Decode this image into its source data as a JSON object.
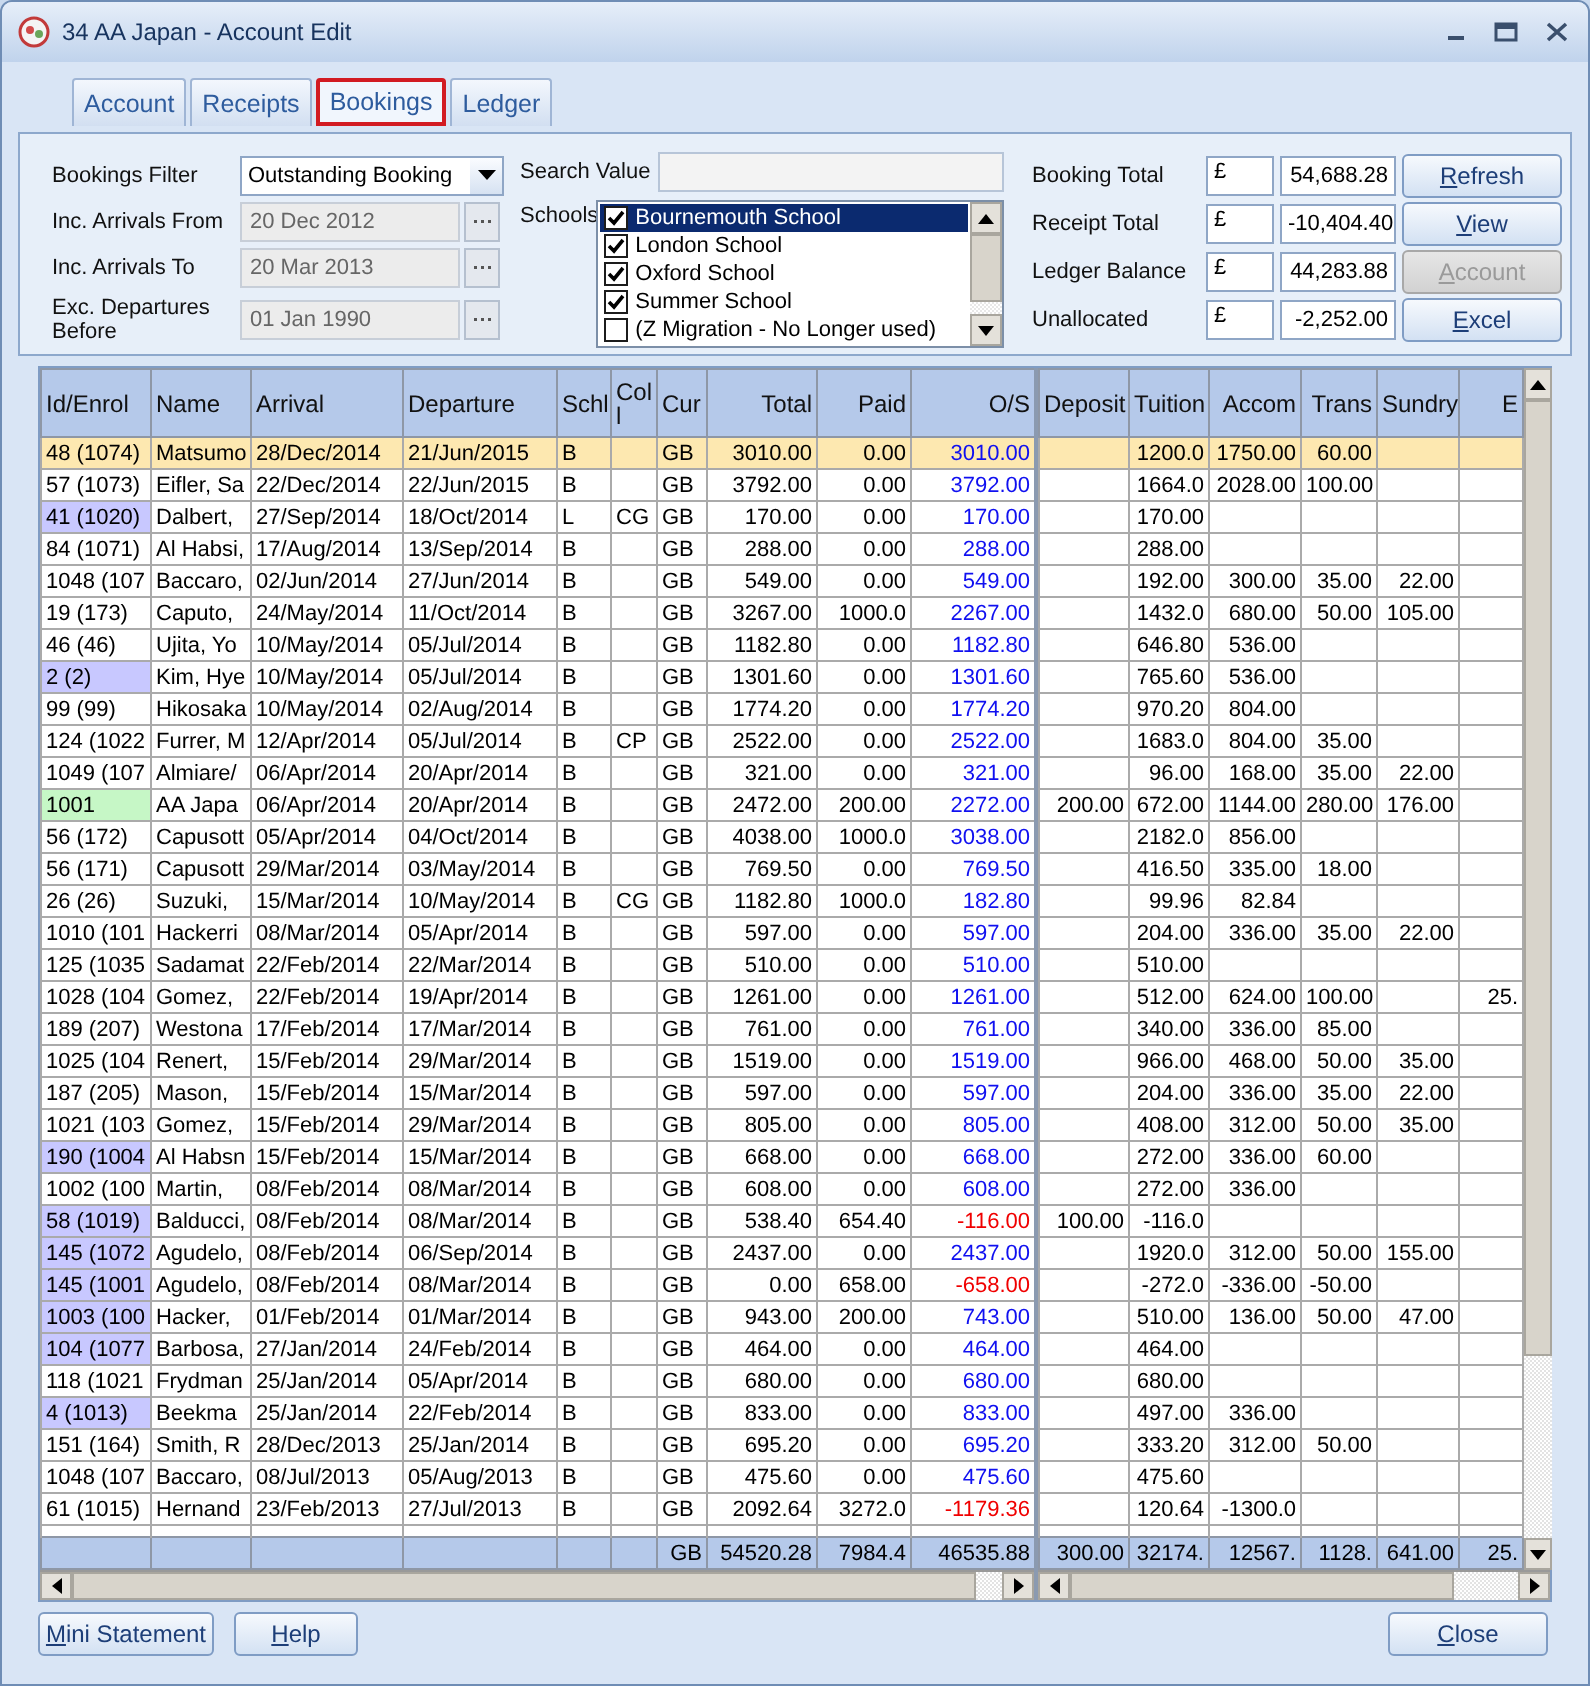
{
  "window": {
    "title": "34 AA Japan - Account Edit"
  },
  "tabs": [
    {
      "label": "Account",
      "selected": false
    },
    {
      "label": "Receipts",
      "selected": false
    },
    {
      "label": "Bookings",
      "selected": true
    },
    {
      "label": "Ledger",
      "selected": false
    }
  ],
  "filter": {
    "bookings_filter": {
      "label": "Bookings Filter",
      "value": "Outstanding Booking"
    },
    "dates": [
      {
        "label": "Inc. Arrivals From",
        "value": "20 Dec 2012",
        "disabled": true
      },
      {
        "label": "Inc. Arrivals To",
        "value": "20 Mar 2013",
        "disabled": true
      },
      {
        "label": "Exc. Departures Before",
        "value": "01 Jan 1990",
        "disabled": true
      }
    ],
    "search": {
      "label": "Search Value"
    },
    "schools": {
      "label": "Schools",
      "items": [
        {
          "label": "Bournemouth School",
          "checked": true,
          "selected": true
        },
        {
          "label": "London School",
          "checked": true,
          "selected": false
        },
        {
          "label": "Oxford School",
          "checked": true,
          "selected": false
        },
        {
          "label": "Summer School",
          "checked": true,
          "selected": false
        },
        {
          "label": "(Z Migration - No Longer used)",
          "checked": false,
          "selected": false
        }
      ]
    },
    "totals": [
      {
        "label": "Booking Total",
        "currency": "£",
        "value": "54,688.28",
        "button": "Refresh",
        "disabled": false
      },
      {
        "label": "Receipt Total",
        "currency": "£",
        "value": "-10,404.40",
        "button": "View",
        "disabled": false
      },
      {
        "label": "Ledger Balance",
        "currency": "£",
        "value": "44,283.88",
        "button": "Account",
        "disabled": true
      },
      {
        "label": "Unallocated",
        "currency": "£",
        "value": "-2,252.00",
        "button": "Excel",
        "disabled": false
      }
    ]
  },
  "grid": {
    "columns_left": [
      {
        "label": "Id/Enrol"
      },
      {
        "label": "Name"
      },
      {
        "label": "Arrival"
      },
      {
        "label": "Departure"
      },
      {
        "label": "Schl"
      },
      {
        "label": "Col l"
      },
      {
        "label": "Cur"
      },
      {
        "label": "Total"
      },
      {
        "label": "Paid"
      },
      {
        "label": "O/S"
      }
    ],
    "columns_right": [
      {
        "label": "Deposit"
      },
      {
        "label": "Tuition"
      },
      {
        "label": "Accom"
      },
      {
        "label": "Trans"
      },
      {
        "label": "Sundry"
      },
      {
        "label": "E"
      }
    ],
    "rows": [
      {
        "selected": true,
        "negative": false,
        "id": "48 (1074)",
        "name": "Matsumo",
        "arrival": "28/Dec/2014",
        "departure": "21/Jun/2015",
        "schl": "B",
        "cur": "GB",
        "total": "3010.00",
        "paid": "0.00",
        "os": "3010.00",
        "tuition": "1200.0",
        "accom": "1750.00",
        "trans": "60.00"
      },
      {
        "selected": false,
        "negative": false,
        "id": "57 (1073)",
        "name": "Eifler, Sa",
        "arrival": "22/Dec/2014",
        "departure": "22/Jun/2015",
        "schl": "B",
        "cur": "GB",
        "total": "3792.00",
        "paid": "0.00",
        "os": "3792.00",
        "tuition": "1664.0",
        "accom": "2028.00",
        "trans": "100.00"
      },
      {
        "selected": false,
        "negative": false,
        "color": "#c8c8ff",
        "id": "41 (1020)",
        "name": "Dalbert,",
        "arrival": "27/Sep/2014",
        "departure": "18/Oct/2014",
        "schl": "L",
        "col": "CG",
        "cur": "GB",
        "total": "170.00",
        "paid": "0.00",
        "os": "170.00",
        "tuition": "170.00"
      },
      {
        "selected": false,
        "negative": false,
        "id": "84 (1071)",
        "name": "Al Habsi,",
        "arrival": "17/Aug/2014",
        "departure": "13/Sep/2014",
        "schl": "B",
        "cur": "GB",
        "total": "288.00",
        "paid": "0.00",
        "os": "288.00",
        "tuition": "288.00"
      },
      {
        "selected": false,
        "negative": false,
        "id": "1048 (107",
        "name": "Baccaro,",
        "arrival": "02/Jun/2014",
        "departure": "27/Jun/2014",
        "schl": "B",
        "cur": "GB",
        "total": "549.00",
        "paid": "0.00",
        "os": "549.00",
        "tuition": "192.00",
        "accom": "300.00",
        "trans": "35.00",
        "sundry": "22.00"
      },
      {
        "selected": false,
        "negative": false,
        "id": "19 (173)",
        "name": "Caputo,",
        "arrival": "24/May/2014",
        "departure": "11/Oct/2014",
        "schl": "B",
        "cur": "GB",
        "total": "3267.00",
        "paid": "1000.0",
        "os": "2267.00",
        "tuition": "1432.0",
        "accom": "680.00",
        "trans": "50.00",
        "sundry": "105.00"
      },
      {
        "selected": false,
        "negative": false,
        "id": "46 (46)",
        "name": "Ujita, Yo",
        "arrival": "10/May/2014",
        "departure": "05/Jul/2014",
        "schl": "B",
        "cur": "GB",
        "total": "1182.80",
        "paid": "0.00",
        "os": "1182.80",
        "tuition": "646.80",
        "accom": "536.00"
      },
      {
        "selected": false,
        "negative": false,
        "color": "#c8c8ff",
        "id": "2 (2)",
        "name": "Kim, Hye",
        "arrival": "10/May/2014",
        "departure": "05/Jul/2014",
        "schl": "B",
        "cur": "GB",
        "total": "1301.60",
        "paid": "0.00",
        "os": "1301.60",
        "tuition": "765.60",
        "accom": "536.00"
      },
      {
        "selected": false,
        "negative": false,
        "id": "99 (99)",
        "name": "Hikosaka",
        "arrival": "10/May/2014",
        "departure": "02/Aug/2014",
        "schl": "B",
        "cur": "GB",
        "total": "1774.20",
        "paid": "0.00",
        "os": "1774.20",
        "tuition": "970.20",
        "accom": "804.00"
      },
      {
        "selected": false,
        "negative": false,
        "id": "124 (1022",
        "name": "Furrer, M",
        "arrival": "12/Apr/2014",
        "departure": "05/Jul/2014",
        "schl": "B",
        "col": "CP",
        "cur": "GB",
        "total": "2522.00",
        "paid": "0.00",
        "os": "2522.00",
        "tuition": "1683.0",
        "accom": "804.00",
        "trans": "35.00"
      },
      {
        "selected": false,
        "negative": false,
        "id": "1049 (107",
        "name": "Almiare/",
        "arrival": "06/Apr/2014",
        "departure": "20/Apr/2014",
        "schl": "B",
        "cur": "GB",
        "total": "321.00",
        "paid": "0.00",
        "os": "321.00",
        "tuition": "96.00",
        "accom": "168.00",
        "trans": "35.00",
        "sundry": "22.00"
      },
      {
        "selected": false,
        "negative": false,
        "color": "#c6f7c6",
        "id": "1001",
        "name": "AA Japa",
        "arrival": "06/Apr/2014",
        "departure": "20/Apr/2014",
        "schl": "B",
        "cur": "GB",
        "total": "2472.00",
        "paid": "200.00",
        "os": "2272.00",
        "deposit": "200.00",
        "tuition": "672.00",
        "accom": "1144.00",
        "trans": "280.00",
        "sundry": "176.00"
      },
      {
        "selected": false,
        "negative": false,
        "id": "56 (172)",
        "name": "Capusott",
        "arrival": "05/Apr/2014",
        "departure": "04/Oct/2014",
        "schl": "B",
        "cur": "GB",
        "total": "4038.00",
        "paid": "1000.0",
        "os": "3038.00",
        "tuition": "2182.0",
        "accom": "856.00"
      },
      {
        "selected": false,
        "negative": false,
        "id": "56 (171)",
        "name": "Capusott",
        "arrival": "29/Mar/2014",
        "departure": "03/May/2014",
        "schl": "B",
        "cur": "GB",
        "total": "769.50",
        "paid": "0.00",
        "os": "769.50",
        "tuition": "416.50",
        "accom": "335.00",
        "trans": "18.00"
      },
      {
        "selected": false,
        "negative": false,
        "id": "26 (26)",
        "name": "Suzuki,",
        "arrival": "15/Mar/2014",
        "departure": "10/May/2014",
        "schl": "B",
        "col": "CG",
        "cur": "GB",
        "total": "1182.80",
        "paid": "1000.0",
        "os": "182.80",
        "tuition": "99.96",
        "accom": "82.84"
      },
      {
        "selected": false,
        "negative": false,
        "id": "1010 (101",
        "name": "Hackerri",
        "arrival": "08/Mar/2014",
        "departure": "05/Apr/2014",
        "schl": "B",
        "cur": "GB",
        "total": "597.00",
        "paid": "0.00",
        "os": "597.00",
        "tuition": "204.00",
        "accom": "336.00",
        "trans": "35.00",
        "sundry": "22.00"
      },
      {
        "selected": false,
        "negative": false,
        "id": "125 (1035",
        "name": "Sadamat",
        "arrival": "22/Feb/2014",
        "departure": "22/Mar/2014",
        "schl": "B",
        "cur": "GB",
        "total": "510.00",
        "paid": "0.00",
        "os": "510.00",
        "tuition": "510.00"
      },
      {
        "selected": false,
        "negative": false,
        "id": "1028 (104",
        "name": "Gomez,",
        "arrival": "22/Feb/2014",
        "departure": "19/Apr/2014",
        "schl": "B",
        "cur": "GB",
        "total": "1261.00",
        "paid": "0.00",
        "os": "1261.00",
        "tuition": "512.00",
        "accom": "624.00",
        "trans": "100.00",
        "column_6": "25."
      },
      {
        "selected": false,
        "negative": false,
        "id": "189 (207)",
        "name": "Westona",
        "arrival": "17/Feb/2014",
        "departure": "17/Mar/2014",
        "schl": "B",
        "cur": "GB",
        "total": "761.00",
        "paid": "0.00",
        "os": "761.00",
        "tuition": "340.00",
        "accom": "336.00",
        "trans": "85.00"
      },
      {
        "selected": false,
        "negative": false,
        "id": "1025 (104",
        "name": "Renert,",
        "arrival": "15/Feb/2014",
        "departure": "29/Mar/2014",
        "schl": "B",
        "cur": "GB",
        "total": "1519.00",
        "paid": "0.00",
        "os": "1519.00",
        "tuition": "966.00",
        "accom": "468.00",
        "trans": "50.00",
        "sundry": "35.00"
      },
      {
        "selected": false,
        "negative": false,
        "id": "187 (205)",
        "name": "Mason,",
        "arrival": "15/Feb/2014",
        "departure": "15/Mar/2014",
        "schl": "B",
        "cur": "GB",
        "total": "597.00",
        "paid": "0.00",
        "os": "597.00",
        "tuition": "204.00",
        "accom": "336.00",
        "trans": "35.00",
        "sundry": "22.00"
      },
      {
        "selected": false,
        "negative": false,
        "id": "1021 (103",
        "name": "Gomez,",
        "arrival": "15/Feb/2014",
        "departure": "29/Mar/2014",
        "schl": "B",
        "cur": "GB",
        "total": "805.00",
        "paid": "0.00",
        "os": "805.00",
        "tuition": "408.00",
        "accom": "312.00",
        "trans": "50.00",
        "sundry": "35.00"
      },
      {
        "selected": false,
        "negative": false,
        "color": "#c8c8ff",
        "id": "190 (1004",
        "name": "Al Habsn",
        "arrival": "15/Feb/2014",
        "departure": "15/Mar/2014",
        "schl": "B",
        "cur": "GB",
        "total": "668.00",
        "paid": "0.00",
        "os": "668.00",
        "tuition": "272.00",
        "accom": "336.00",
        "trans": "60.00"
      },
      {
        "selected": false,
        "negative": false,
        "id": "1002 (100",
        "name": "Martin,",
        "arrival": "08/Feb/2014",
        "departure": "08/Mar/2014",
        "schl": "B",
        "cur": "GB",
        "total": "608.00",
        "paid": "0.00",
        "os": "608.00",
        "tuition": "272.00",
        "accom": "336.00"
      },
      {
        "selected": false,
        "negative": true,
        "color": "#c8c8ff",
        "id": "58 (1019)",
        "name": "Balducci,",
        "arrival": "08/Feb/2014",
        "departure": "08/Mar/2014",
        "schl": "B",
        "cur": "GB",
        "total": "538.40",
        "paid": "654.40",
        "os": "-116.00",
        "deposit": "100.00",
        "tuition": "-116.0"
      },
      {
        "selected": false,
        "negative": false,
        "color": "#c8c8ff",
        "id": "145 (1072",
        "name": "Agudelo,",
        "arrival": "08/Feb/2014",
        "departure": "06/Sep/2014",
        "schl": "B",
        "cur": "GB",
        "total": "2437.00",
        "paid": "0.00",
        "os": "2437.00",
        "tuition": "1920.0",
        "accom": "312.00",
        "trans": "50.00",
        "sundry": "155.00"
      },
      {
        "selected": false,
        "negative": true,
        "color": "#c8c8ff",
        "id": "145 (1001",
        "name": "Agudelo,",
        "arrival": "08/Feb/2014",
        "departure": "08/Mar/2014",
        "schl": "B",
        "cur": "GB",
        "total": "0.00",
        "paid": "658.00",
        "os": "-658.00",
        "tuition": "-272.0",
        "accom": "-336.00",
        "trans": "-50.00"
      },
      {
        "selected": false,
        "negative": false,
        "color": "#c8c8ff",
        "id": "1003 (100",
        "name": "Hacker,",
        "arrival": "01/Feb/2014",
        "departure": "01/Mar/2014",
        "schl": "B",
        "cur": "GB",
        "total": "943.00",
        "paid": "200.00",
        "os": "743.00",
        "tuition": "510.00",
        "accom": "136.00",
        "trans": "50.00",
        "sundry": "47.00"
      },
      {
        "selected": false,
        "negative": false,
        "color": "#c8c8ff",
        "id": "104 (1077",
        "name": "Barbosa,",
        "arrival": "27/Jan/2014",
        "departure": "24/Feb/2014",
        "schl": "B",
        "cur": "GB",
        "total": "464.00",
        "paid": "0.00",
        "os": "464.00",
        "tuition": "464.00"
      },
      {
        "selected": false,
        "negative": false,
        "id": "118 (1021",
        "name": "Frydman",
        "arrival": "25/Jan/2014",
        "departure": "05/Apr/2014",
        "schl": "B",
        "cur": "GB",
        "total": "680.00",
        "paid": "0.00",
        "os": "680.00",
        "tuition": "680.00"
      },
      {
        "selected": false,
        "negative": false,
        "color": "#c8c8ff",
        "id": "4 (1013)",
        "name": "Beekma",
        "arrival": "25/Jan/2014",
        "departure": "22/Feb/2014",
        "schl": "B",
        "cur": "GB",
        "total": "833.00",
        "paid": "0.00",
        "os": "833.00",
        "tuition": "497.00",
        "accom": "336.00"
      },
      {
        "selected": false,
        "negative": false,
        "id": "151 (164)",
        "name": "Smith, R",
        "arrival": "28/Dec/2013",
        "departure": "25/Jan/2014",
        "schl": "B",
        "cur": "GB",
        "total": "695.20",
        "paid": "0.00",
        "os": "695.20",
        "tuition": "333.20",
        "accom": "312.00",
        "trans": "50.00"
      },
      {
        "selected": false,
        "negative": false,
        "id": "1048 (107",
        "name": "Baccaro,",
        "arrival": "08/Jul/2013",
        "departure": "05/Aug/2013",
        "schl": "B",
        "cur": "GB",
        "total": "475.60",
        "paid": "0.00",
        "os": "475.60",
        "tuition": "475.60"
      },
      {
        "selected": false,
        "negative": true,
        "id": "61 (1015)",
        "name": "Hernand",
        "arrival": "23/Feb/2013",
        "departure": "27/Jul/2013",
        "schl": "B",
        "cur": "GB",
        "total": "2092.64",
        "paid": "3272.0",
        "os": "-1179.36",
        "tuition": "120.64",
        "accom": "-1300.0"
      }
    ],
    "totals": {
      "cur": "GB",
      "total": "54520.28",
      "paid": "7984.4",
      "os": "46535.88",
      "deposit": "300.00",
      "tuition": "32174.",
      "accom": "12567.",
      "trans": "1128.",
      "sundry": "641.00",
      "column_6": "25."
    }
  },
  "footer": {
    "buttons": [
      {
        "label": "Mini Statement",
        "kind": "left"
      },
      {
        "label": "Help",
        "kind": "left"
      },
      {
        "label": "Close",
        "kind": "right"
      }
    ]
  }
}
